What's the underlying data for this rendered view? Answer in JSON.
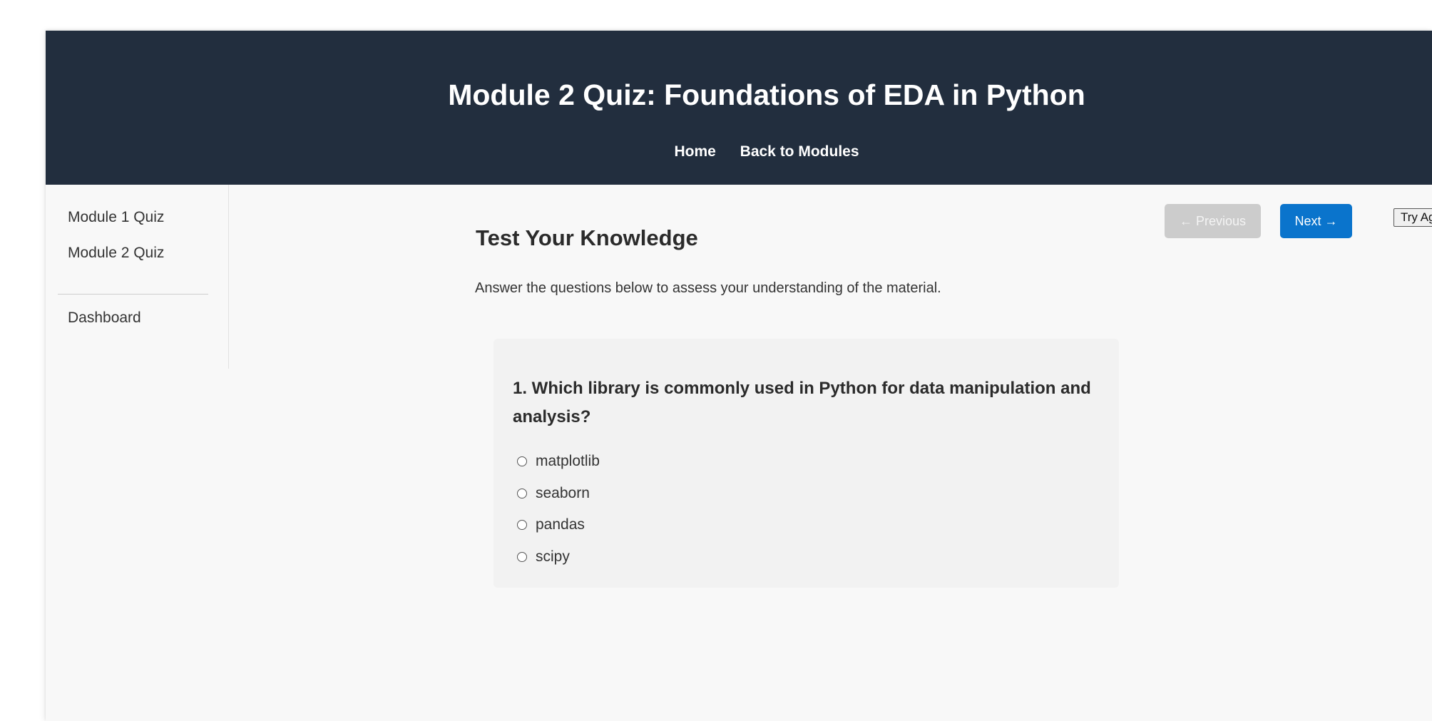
{
  "header": {
    "title": "Module 2 Quiz: Foundations of EDA in Python",
    "nav": [
      {
        "label": "Home"
      },
      {
        "label": "Back to Modules"
      }
    ]
  },
  "sidebar": {
    "items": [
      {
        "label": "Module 1 Quiz"
      },
      {
        "label": "Module 2 Quiz"
      }
    ],
    "footer_item": {
      "label": "Dashboard"
    }
  },
  "controls": {
    "previous_label": "← Previous",
    "next_label": "Next →",
    "try_again_label": "Try Again"
  },
  "main": {
    "heading": "Test Your Knowledge",
    "intro": "Answer the questions below to assess your understanding of the material."
  },
  "questions": [
    {
      "text": "1. Which library is commonly used in Python for data manipulation and analysis?",
      "options": [
        "matplotlib",
        "seaborn",
        "pandas",
        "scipy"
      ]
    }
  ]
}
